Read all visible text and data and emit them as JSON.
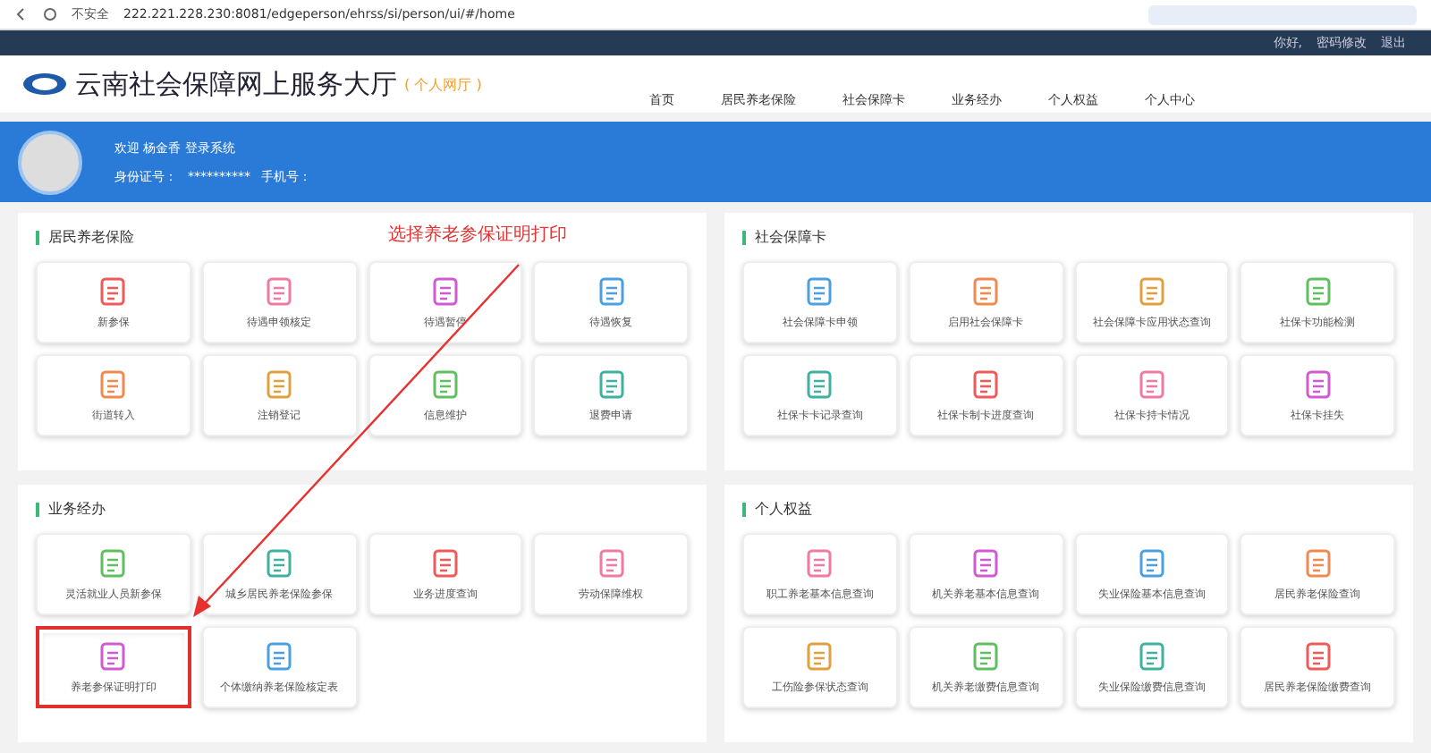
{
  "browser": {
    "security": "不安全",
    "address": "222.221.228.230:8081/edgeperson/ehrss/si/person/ui/#/home"
  },
  "top_bar": {
    "greeting": "你好,",
    "links": [
      "密码修改",
      "退出"
    ]
  },
  "header": {
    "title": "云南社会保障网上服务大厅",
    "subtitle": "( 个人网厅 )",
    "nav": [
      {
        "label": "首页",
        "selected": false
      },
      {
        "label": "居民养老保险",
        "selected": false
      },
      {
        "label": "社会保障卡",
        "selected": false
      },
      {
        "label": "业务经办",
        "selected": false
      },
      {
        "label": "个人权益",
        "selected": false
      },
      {
        "label": "个人中心",
        "selected": false
      }
    ]
  },
  "banner": {
    "welcome": "欢迎 杨金香 登录系统",
    "id_label": "身份证号：",
    "id_value": "**********",
    "phone_label": "手机号："
  },
  "annotation": "选择养老参保证明打印",
  "sections": [
    {
      "title": "居民养老保险",
      "tiles": [
        {
          "label": "新参保",
          "highlighted": false
        },
        {
          "label": "待遇申领核定",
          "highlighted": false
        },
        {
          "label": "待遇暂停",
          "highlighted": false
        },
        {
          "label": "待遇恢复",
          "highlighted": false
        },
        {
          "label": "街道转入",
          "highlighted": false
        },
        {
          "label": "注销登记",
          "highlighted": false
        },
        {
          "label": "信息维护",
          "highlighted": false
        },
        {
          "label": "退费申请",
          "highlighted": false
        }
      ]
    },
    {
      "title": "社会保障卡",
      "tiles": [
        {
          "label": "社会保障卡申领",
          "highlighted": false
        },
        {
          "label": "启用社会保障卡",
          "highlighted": false
        },
        {
          "label": "社会保障卡应用状态查询",
          "highlighted": false
        },
        {
          "label": "社保卡功能检测",
          "highlighted": false
        },
        {
          "label": "社保卡卡记录查询",
          "highlighted": false
        },
        {
          "label": "社保卡制卡进度查询",
          "highlighted": false
        },
        {
          "label": "社保卡持卡情况",
          "highlighted": false
        },
        {
          "label": "社保卡挂失",
          "highlighted": false
        }
      ]
    },
    {
      "title": "业务经办",
      "tiles": [
        {
          "label": "灵活就业人员新参保",
          "highlighted": false
        },
        {
          "label": "城乡居民养老保险参保",
          "highlighted": false
        },
        {
          "label": "业务进度查询",
          "highlighted": false
        },
        {
          "label": "劳动保障维权",
          "highlighted": false
        },
        {
          "label": "养老参保证明打印",
          "highlighted": true
        },
        {
          "label": "个体缴纳养老保险核定表",
          "highlighted": false
        }
      ]
    },
    {
      "title": "个人权益",
      "tiles": [
        {
          "label": "职工养老基本信息查询",
          "highlighted": false
        },
        {
          "label": "机关养老基本信息查询",
          "highlighted": false
        },
        {
          "label": "失业保险基本信息查询",
          "highlighted": false
        },
        {
          "label": "居民养老保险查询",
          "highlighted": false
        },
        {
          "label": "工伤险参保状态查询",
          "highlighted": false
        },
        {
          "label": "机关养老缴费信息查询",
          "highlighted": false
        },
        {
          "label": "失业保险缴费信息查询",
          "highlighted": false
        },
        {
          "label": "居民养老保险缴费查询",
          "highlighted": false
        }
      ]
    }
  ]
}
